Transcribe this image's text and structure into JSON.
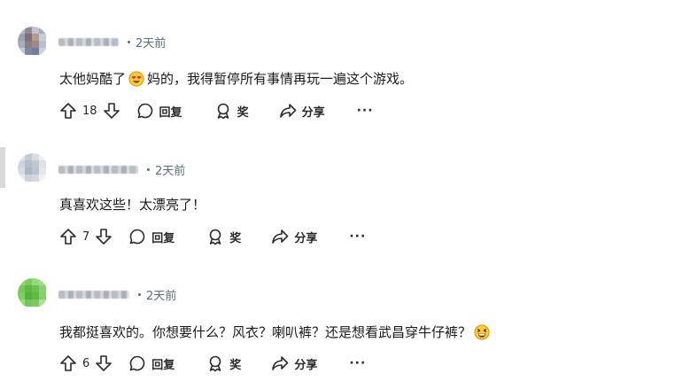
{
  "comments": [
    {
      "time": "2天前",
      "text_before": "太他妈酷了",
      "emoji": "heart-eyes-emoji",
      "text_after": "妈的，我得暂停所有事情再玩一遍这个游戏。",
      "votes": "18",
      "reply_label": "回复",
      "award_label": "奖",
      "share_label": "分享",
      "more_label": "···"
    },
    {
      "time": "2天前",
      "text_before": "真喜欢这些！太漂亮了！",
      "votes": "7",
      "reply_label": "回复",
      "award_label": "奖",
      "share_label": "分享",
      "more_label": "···"
    },
    {
      "time": "2天前",
      "text_before": "我都挺喜欢的。你想要什么？风衣？喇叭裤？还是想看武昌穿牛仔裤？",
      "emoji": "grinning-squint-emoji",
      "votes": "6",
      "reply_label": "回复",
      "award_label": "奖",
      "share_label": "分享",
      "more_label": "···"
    }
  ],
  "colors": {
    "meta_text": "#576f76",
    "thread_line": "#d9d9d9",
    "avatar_1": "#9fa7b5",
    "avatar_2": "#c7ccd4",
    "avatar_3": "#7fd164"
  }
}
